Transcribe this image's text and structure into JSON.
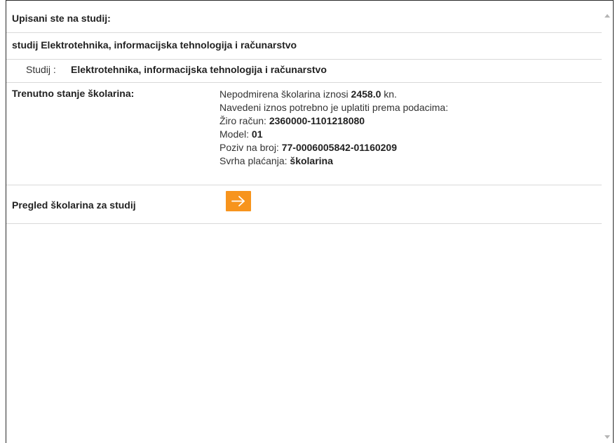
{
  "header": {
    "title": "Upisani ste na studij:"
  },
  "study": {
    "name": "studij Elektrotehnika, informacijska tehnologija i računarstvo",
    "detail_label": "Studij :",
    "detail_value": "Elektrotehnika, informacijska tehnologija i računarstvo"
  },
  "tuition": {
    "label": "Trenutno stanje školarina:",
    "outstanding_prefix": "Nepodmirena školarina iznosi",
    "outstanding_amount": "2458.0",
    "outstanding_suffix": "kn.",
    "instructions": "Navedeni iznos potrebno je uplatiti prema podacima:",
    "account_label": "Žiro račun:",
    "account_value": "2360000-1101218080",
    "model_label": "Model:",
    "model_value": "01",
    "reference_label": "Poziv na broj:",
    "reference_value": "77-0006005842-01160209",
    "purpose_label": "Svrha plaćanja:",
    "purpose_value": "školarina"
  },
  "overview": {
    "label": "Pregled školarina za studij"
  },
  "colors": {
    "accent": "#f7941d",
    "border": "#d9d9d9"
  },
  "icons": {
    "arrow": "arrow-right-icon"
  }
}
